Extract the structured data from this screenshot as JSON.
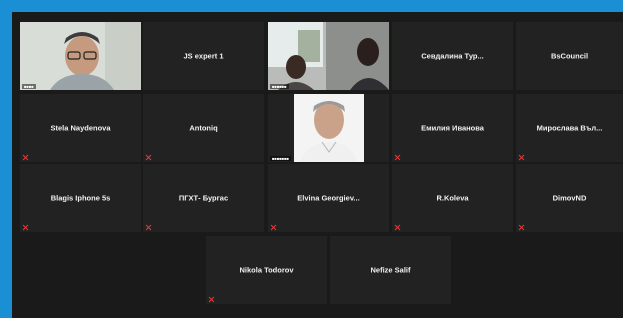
{
  "participants": {
    "row1": [
      {
        "name": "",
        "video": true
      },
      {
        "name": "JS expert 1"
      },
      {
        "name": "",
        "video": true
      },
      {
        "name": "Севдалина Тур..."
      },
      {
        "name": "BsCouncil"
      }
    ],
    "row2": [
      {
        "name": "Stela Naydenova"
      },
      {
        "name": "Antoniq"
      },
      {
        "name": "",
        "video": true
      },
      {
        "name": "Емилия Иванова"
      },
      {
        "name": "Мирослава Въл..."
      }
    ],
    "row3": [
      {
        "name": "Blagis Iphone 5s"
      },
      {
        "name": "ПГХТ- Бургас"
      },
      {
        "name": "Elvina Georgiev..."
      },
      {
        "name": "R.Koleva"
      },
      {
        "name": "DimovND"
      }
    ],
    "row4": [
      {
        "name": "Nikola Todorov"
      },
      {
        "name": "Nefize Salif"
      }
    ]
  },
  "colors": {
    "tile_bg": "#222222",
    "frame": "#1b8fd3",
    "mic_muted": "#e03c3c"
  }
}
